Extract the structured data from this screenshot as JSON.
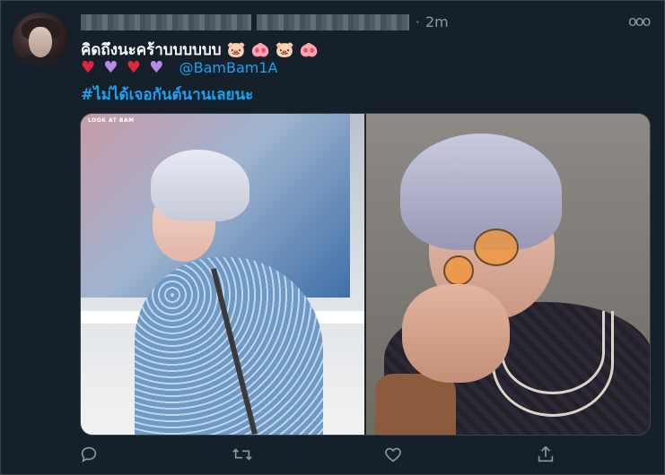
{
  "tweet": {
    "time": "2m",
    "dot": "·",
    "more": "ooo",
    "text_line": "คิดถึงนะคร้าบบบบบบ",
    "text_emojis": [
      "🐷",
      "🐽",
      "🐷",
      "🐽"
    ],
    "hearts": [
      "♥",
      "♥",
      "♥",
      "♥"
    ],
    "mention": "@BamBam1A",
    "hashtag": "#ไม่ได้เจอกันต์นานเลยนะ"
  },
  "media": {
    "left_badge": "LOOK AT BAM"
  },
  "actions": {
    "reply": "reply-icon",
    "retweet": "retweet-icon",
    "like": "heart-icon",
    "share": "share-icon"
  },
  "colors": {
    "background": "#15202b",
    "border": "#38444d",
    "secondary_text": "#8899a6",
    "link": "#1da1f2",
    "heart_red": "#e0253c",
    "heart_purple": "#b48ae6"
  }
}
